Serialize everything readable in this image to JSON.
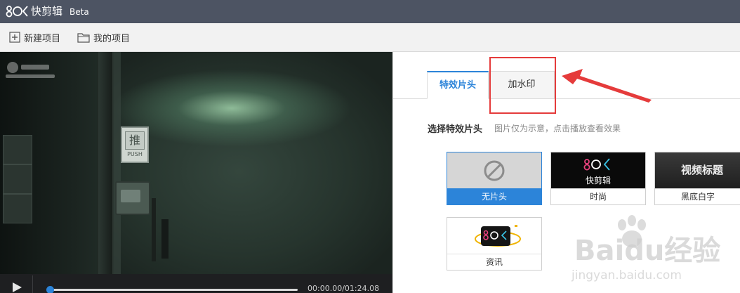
{
  "titlebar": {
    "app_name": "快剪辑",
    "beta": "Beta",
    "logo_text": "8OK"
  },
  "toolbar": {
    "new_project": "新建项目",
    "my_projects": "我的项目"
  },
  "player": {
    "timecode": "00:00.00/01:24.08",
    "progress": 0.01,
    "door_sign_glyph": "推",
    "door_sign_text": "PUSH"
  },
  "panel": {
    "tabs": [
      {
        "label": "特效片头",
        "active": true
      },
      {
        "label": "加水印",
        "active": false
      }
    ],
    "section_title": "选择特效片头",
    "section_hint": "图片仅为示意，点击播放查看效果",
    "cards": [
      {
        "label": "无片头",
        "selected": true,
        "icon": "prohibited-icon"
      },
      {
        "label": "时尚",
        "selected": false,
        "thumb_text": "快剪辑",
        "thumb_logo": "8OK"
      },
      {
        "label": "黑底白字",
        "selected": false,
        "thumb_text": "视频标题"
      },
      {
        "label": "资讯",
        "selected": false,
        "thumb_logo": "8OK"
      }
    ]
  },
  "watermark": {
    "brand": "Baidu经验",
    "url": "jingyan.baidu.com"
  },
  "colors": {
    "titlebar": "#4d5463",
    "accent": "#2c84d9",
    "highlight": "#e53b3b"
  }
}
